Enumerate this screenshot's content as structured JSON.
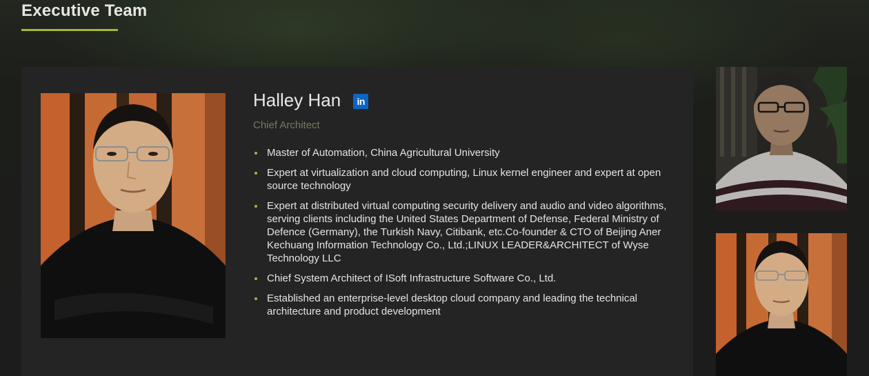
{
  "section": {
    "title": "Executive Team"
  },
  "featured": {
    "name": "Halley Han",
    "linkedin_label": "in",
    "role": "Chief Architect",
    "bullets": [
      "Master of Automation, China Agricultural University",
      "Expert at virtualization and cloud computing, Linux kernel engineer and expert at open source technology",
      "Expert at distributed virtual computing security delivery and audio and video algorithms, serving clients including the United States Department of Defense, Federal Ministry of Defence (Germany), the Turkish Navy, Citibank, etc.Co-founder & CTO of Beijing Aner Kechuang Information Technology Co., Ltd.;LINUX LEADER&ARCHITECT of Wyse Technology LLC",
      "Chief System Architect of ISoft Infrastructure Software Co., Ltd.",
      "Established an enterprise-level desktop cloud company and leading the technical architecture and product development"
    ]
  },
  "colors": {
    "accent": "#a6b83a",
    "role_text": "#767a5e",
    "card_bg": "#242424",
    "linkedin": "#0a66c2"
  },
  "icons": {
    "linkedin": "linkedin-icon"
  }
}
